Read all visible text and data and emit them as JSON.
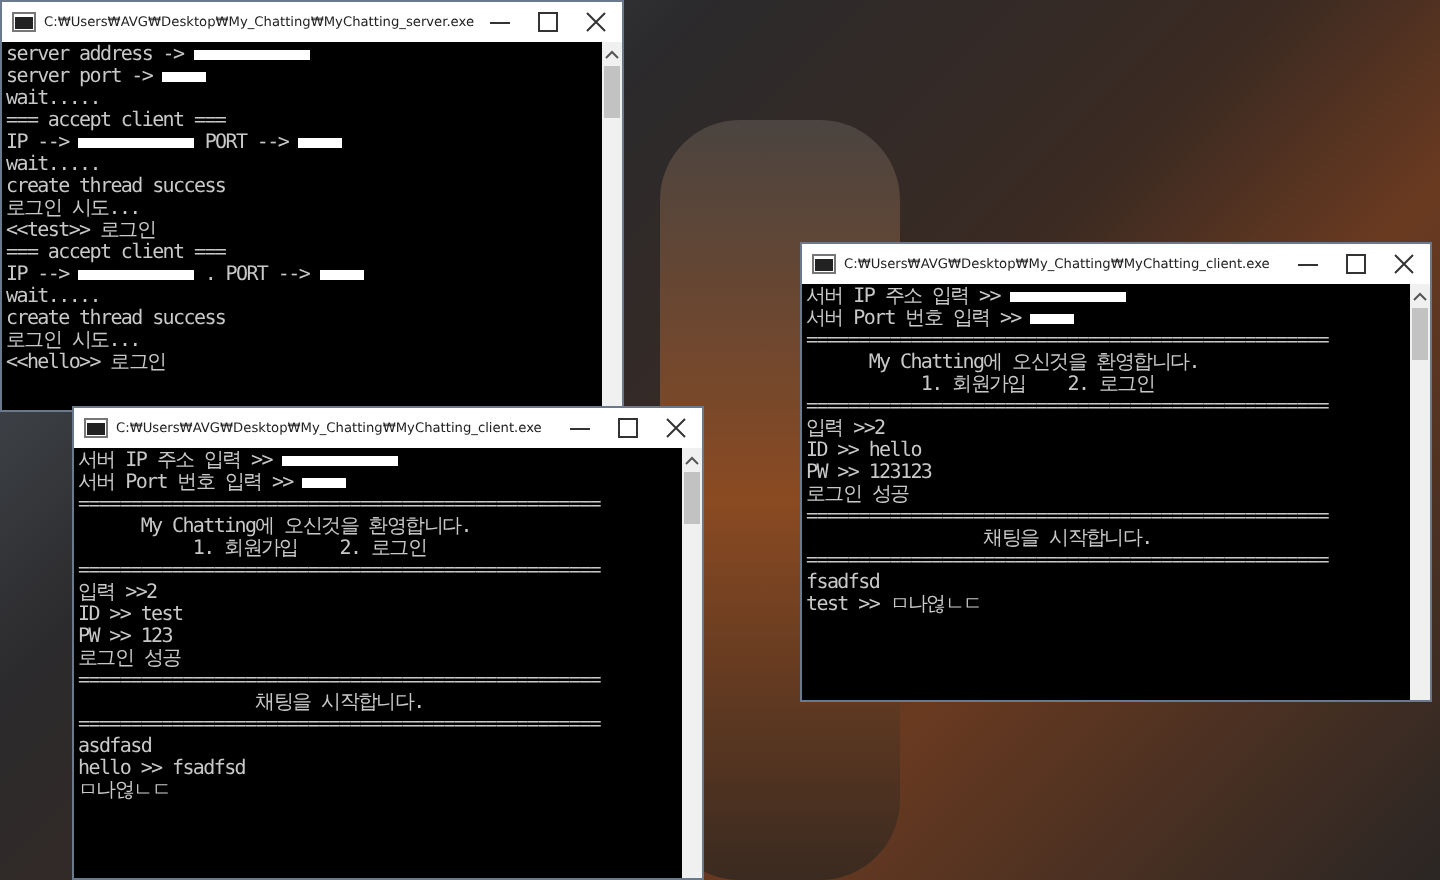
{
  "windows": [
    {
      "title": "C:₩Users₩AVG₩Desktop₩My_Chatting₩MyChatting_server.exe",
      "lines": [
        [
          {
            "kind": "text",
            "text": "server address ->"
          },
          {
            "kind": "mask-long"
          }
        ],
        [
          {
            "kind": "text",
            "text": "server port ->"
          },
          {
            "kind": "mask-short"
          }
        ],
        [
          {
            "kind": "text",
            "text": "wait....."
          }
        ],
        [
          {
            "kind": "text",
            "text": "=== accept client ==="
          }
        ],
        [
          {
            "kind": "text",
            "text": "IP -->"
          },
          {
            "kind": "mask-long"
          },
          {
            "kind": "text",
            "text": "PORT -->"
          },
          {
            "kind": "mask-short"
          }
        ],
        [
          {
            "kind": "text",
            "text": "wait....."
          }
        ],
        [
          {
            "kind": "text",
            "text": "create thread success"
          }
        ],
        [
          {
            "kind": "text",
            "text": "로그인 시도..."
          }
        ],
        [
          {
            "kind": "text",
            "text": "<<test>> 로그인"
          }
        ],
        [
          {
            "kind": "text",
            "text": "=== accept client ==="
          }
        ],
        [
          {
            "kind": "text",
            "text": "IP -->"
          },
          {
            "kind": "mask-long"
          },
          {
            "kind": "text",
            "text": ". PORT -->"
          },
          {
            "kind": "mask-short"
          }
        ],
        [
          {
            "kind": "text",
            "text": "wait....."
          }
        ],
        [
          {
            "kind": "text",
            "text": "create thread success"
          }
        ],
        [
          {
            "kind": "text",
            "text": "로그인 시도..."
          }
        ],
        [
          {
            "kind": "text",
            "text": "<<hello>> 로그인"
          }
        ]
      ]
    },
    {
      "title": "C:₩Users₩AVG₩Desktop₩My_Chatting₩MyChatting_client.exe",
      "lines": [
        [
          {
            "kind": "text",
            "text": "서버 IP 주소 입력 >>"
          },
          {
            "kind": "mask-long"
          }
        ],
        [
          {
            "kind": "text",
            "text": "서버 Port 번호 입력 >>"
          },
          {
            "kind": "mask-short"
          }
        ],
        [
          {
            "kind": "text",
            "text": "=================================================="
          }
        ],
        [
          {
            "kind": "text",
            "text": "      My Chatting에 오신것을 환영합니다."
          }
        ],
        [
          {
            "kind": "text",
            "text": "           1. 회원가입    2. 로그인"
          }
        ],
        [
          {
            "kind": "text",
            "text": "=================================================="
          }
        ],
        [
          {
            "kind": "text",
            "text": "입력 >>2"
          }
        ],
        [
          {
            "kind": "text",
            "text": "ID >> test"
          }
        ],
        [
          {
            "kind": "text",
            "text": "PW >> 123"
          }
        ],
        [
          {
            "kind": "text",
            "text": "로그인 성공"
          }
        ],
        [
          {
            "kind": "text",
            "text": "=================================================="
          }
        ],
        [
          {
            "kind": "text",
            "text": "                 채팅을 시작합니다."
          }
        ],
        [
          {
            "kind": "text",
            "text": "=================================================="
          }
        ],
        [
          {
            "kind": "text",
            "text": "asdfasd"
          }
        ],
        [
          {
            "kind": "text",
            "text": "hello >> fsadfsd"
          }
        ],
        [
          {
            "kind": "text",
            "text": "ㅁ나얺ㄴㄷ"
          }
        ]
      ]
    },
    {
      "title": "C:₩Users₩AVG₩Desktop₩My_Chatting₩MyChatting_client.exe",
      "lines": [
        [
          {
            "kind": "text",
            "text": "서버 IP 주소 입력 >>"
          },
          {
            "kind": "mask-long"
          }
        ],
        [
          {
            "kind": "text",
            "text": "서버 Port 번호 입력 >>"
          },
          {
            "kind": "mask-short"
          }
        ],
        [
          {
            "kind": "text",
            "text": "=================================================="
          }
        ],
        [
          {
            "kind": "text",
            "text": "      My Chatting에 오신것을 환영합니다."
          }
        ],
        [
          {
            "kind": "text",
            "text": "           1. 회원가입    2. 로그인"
          }
        ],
        [
          {
            "kind": "text",
            "text": "=================================================="
          }
        ],
        [
          {
            "kind": "text",
            "text": "입력 >>2"
          }
        ],
        [
          {
            "kind": "text",
            "text": "ID >> hello"
          }
        ],
        [
          {
            "kind": "text",
            "text": "PW >> 123123"
          }
        ],
        [
          {
            "kind": "text",
            "text": "로그인 성공"
          }
        ],
        [
          {
            "kind": "text",
            "text": "=================================================="
          }
        ],
        [
          {
            "kind": "text",
            "text": "                 채팅을 시작합니다."
          }
        ],
        [
          {
            "kind": "text",
            "text": "=================================================="
          }
        ],
        [
          {
            "kind": "text",
            "text": "fsadfsd"
          }
        ],
        [
          {
            "kind": "text",
            "text": "test >> ㅁ나얺ㄴㄷ"
          }
        ]
      ]
    }
  ]
}
